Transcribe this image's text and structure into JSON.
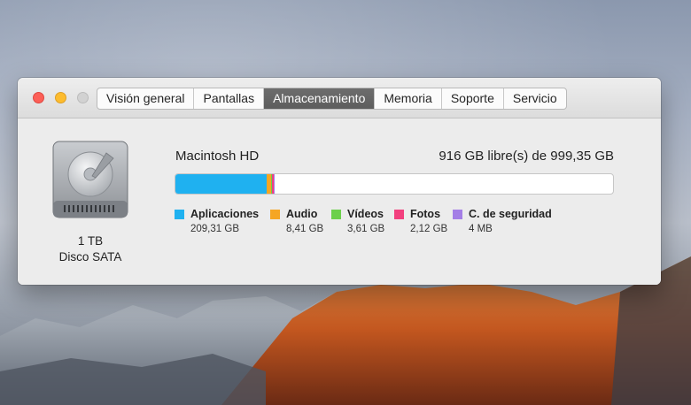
{
  "tabs": [
    {
      "label": "Visión general",
      "active": false
    },
    {
      "label": "Pantallas",
      "active": false
    },
    {
      "label": "Almacenamiento",
      "active": true
    },
    {
      "label": "Memoria",
      "active": false
    },
    {
      "label": "Soporte",
      "active": false
    },
    {
      "label": "Servicio",
      "active": false
    }
  ],
  "disk": {
    "capacity": "1 TB",
    "type": "Disco SATA",
    "name": "Macintosh HD",
    "free_text": "916 GB libre(s) de 999,35 GB"
  },
  "storage": {
    "total_gb": 999.35,
    "categories": [
      {
        "label": "Aplicaciones",
        "value": "209,31 GB",
        "gb": 209.31,
        "color": "#1fb1f0"
      },
      {
        "label": "Audio",
        "value": "8,41 GB",
        "gb": 8.41,
        "color": "#f5a623"
      },
      {
        "label": "Vídeos",
        "value": "3,61 GB",
        "gb": 3.61,
        "color": "#6cd04b"
      },
      {
        "label": "Fotos",
        "value": "2,12 GB",
        "gb": 2.12,
        "color": "#f2407e"
      },
      {
        "label": "C. de seguridad",
        "value": "4 MB",
        "gb": 0.004,
        "color": "#a47ee6"
      }
    ]
  }
}
